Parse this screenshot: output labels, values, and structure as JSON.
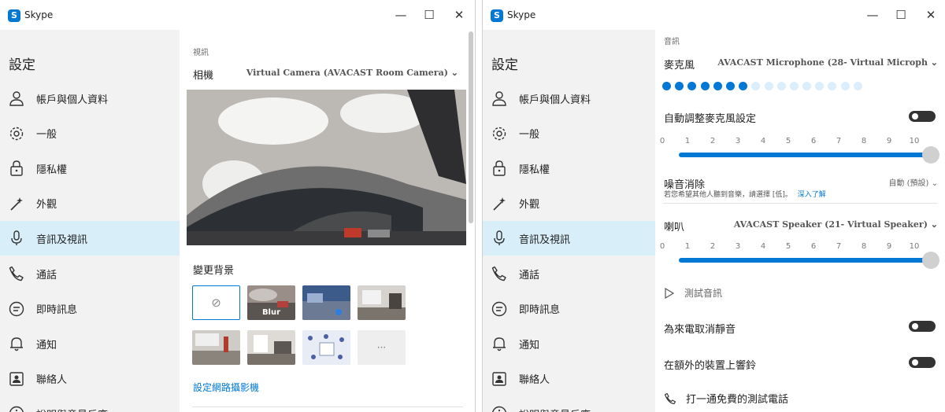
{
  "app": {
    "title": "Skype",
    "logo_letter": "S"
  },
  "titlebar": {
    "minimize_label": "—",
    "maximize_label": "☐",
    "close_label": "✕"
  },
  "sidebar": {
    "title": "設定",
    "items": [
      {
        "label": "帳戶與個人資料",
        "icon": "person-icon"
      },
      {
        "label": "一般",
        "icon": "gear-icon"
      },
      {
        "label": "隱私權",
        "icon": "lock-icon"
      },
      {
        "label": "外觀",
        "icon": "magic-wand-icon"
      },
      {
        "label": "音訊及視訊",
        "icon": "microphone-icon",
        "active": true
      },
      {
        "label": "通話",
        "icon": "phone-icon"
      },
      {
        "label": "即時訊息",
        "icon": "chat-icon"
      },
      {
        "label": "通知",
        "icon": "bell-icon"
      },
      {
        "label": "聯絡人",
        "icon": "contact-card-icon"
      },
      {
        "label": "說明與意見反應",
        "icon": "info-icon"
      }
    ]
  },
  "video": {
    "section_label": "視訊",
    "camera_label": "相機",
    "camera_value": "Virtual Camera (AVACAST Room Camera)",
    "background_label": "變更背景",
    "blur_label": "Blur",
    "none_symbol": "⊘",
    "more_symbol": "···",
    "webcam_link": "設定網路攝影機"
  },
  "audio": {
    "section_label": "音訊",
    "microphone_label": "麥克風",
    "microphone_value": "AVACAST Microphone (28- Virtual Microph",
    "mic_level_dots_total": 16,
    "mic_level_dots_active": 7,
    "auto_adjust_label": "自動調整麥克風設定",
    "auto_adjust_on": false,
    "scale_ticks": [
      "0",
      "1",
      "2",
      "3",
      "4",
      "5",
      "6",
      "7",
      "8",
      "9",
      "10"
    ],
    "mic_volume": 10,
    "noise_label": "噪音消除",
    "noise_value": "自動 (預設)",
    "noise_hint": "若您希望其他人聽到音樂，請選擇 [低]。",
    "noise_link": "深入了解",
    "speaker_label": "喇叭",
    "speaker_value": "AVACAST Speaker (21- Virtual Speaker)",
    "speaker_volume": 10,
    "test_audio_label": "測試音訊",
    "unmute_label": "為來電取消靜音",
    "unmute_on": false,
    "ring_label": "在額外的裝置上響鈴",
    "ring_on": false,
    "test_call_label": "打一通免費的測試電話"
  },
  "colors": {
    "accent": "#0078d4",
    "active_bg": "#d8eef9",
    "sidebar_bg": "#f2f2f2",
    "dot_inactive": "#dceefb"
  }
}
